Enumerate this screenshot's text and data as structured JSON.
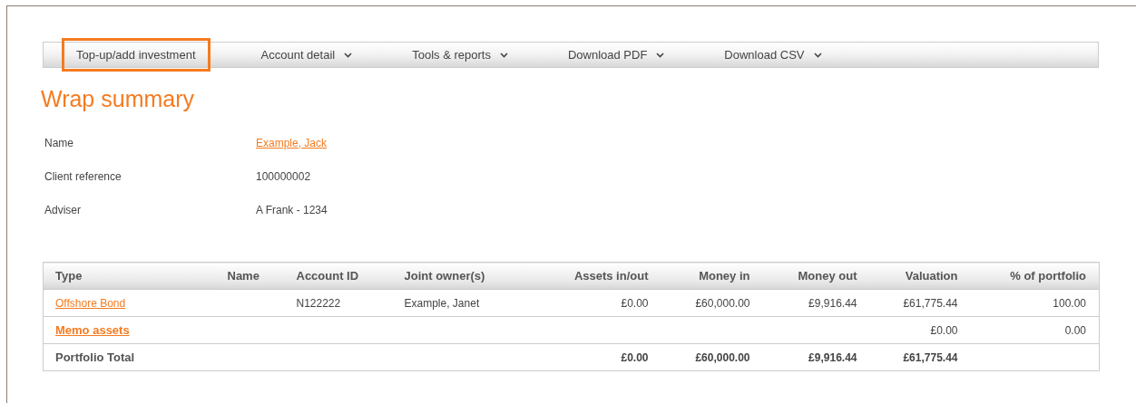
{
  "menu": [
    {
      "label": "Top-up/add investment",
      "dropdown": false,
      "highlighted": true
    },
    {
      "label": "Account detail",
      "dropdown": true,
      "highlighted": false
    },
    {
      "label": "Tools & reports",
      "dropdown": true,
      "highlighted": false
    },
    {
      "label": "Download PDF",
      "dropdown": true,
      "highlighted": false
    },
    {
      "label": "Download CSV",
      "dropdown": true,
      "highlighted": false
    }
  ],
  "title": "Wrap summary",
  "details": [
    {
      "label": "Name",
      "value": "Example, Jack",
      "kind": "link"
    },
    {
      "label": "Client reference",
      "value": "100000002",
      "kind": "text"
    },
    {
      "label": "Adviser",
      "value": "A Frank - 1234",
      "kind": "text"
    }
  ],
  "table": {
    "columns": [
      "Type",
      "Name",
      "Account ID",
      "Joint owner(s)",
      "Assets in/out",
      "Money in",
      "Money out",
      "Valuation",
      "% of portfolio"
    ],
    "rows": [
      {
        "kind": "link",
        "cells": [
          "Offshore Bond",
          "",
          "N122222",
          "Example, Janet",
          "£0.00",
          "£60,000.00",
          "£9,916.44",
          "£61,775.44",
          "100.00"
        ]
      },
      {
        "kind": "bold-link",
        "cells": [
          "Memo assets",
          "",
          "",
          "",
          "",
          "",
          "",
          "£0.00",
          "0.00"
        ]
      },
      {
        "kind": "total",
        "cells": [
          "Portfolio Total",
          "",
          "",
          "",
          "£0.00",
          "£60,000.00",
          "£9,916.44",
          "£61,775.44",
          ""
        ]
      }
    ]
  }
}
